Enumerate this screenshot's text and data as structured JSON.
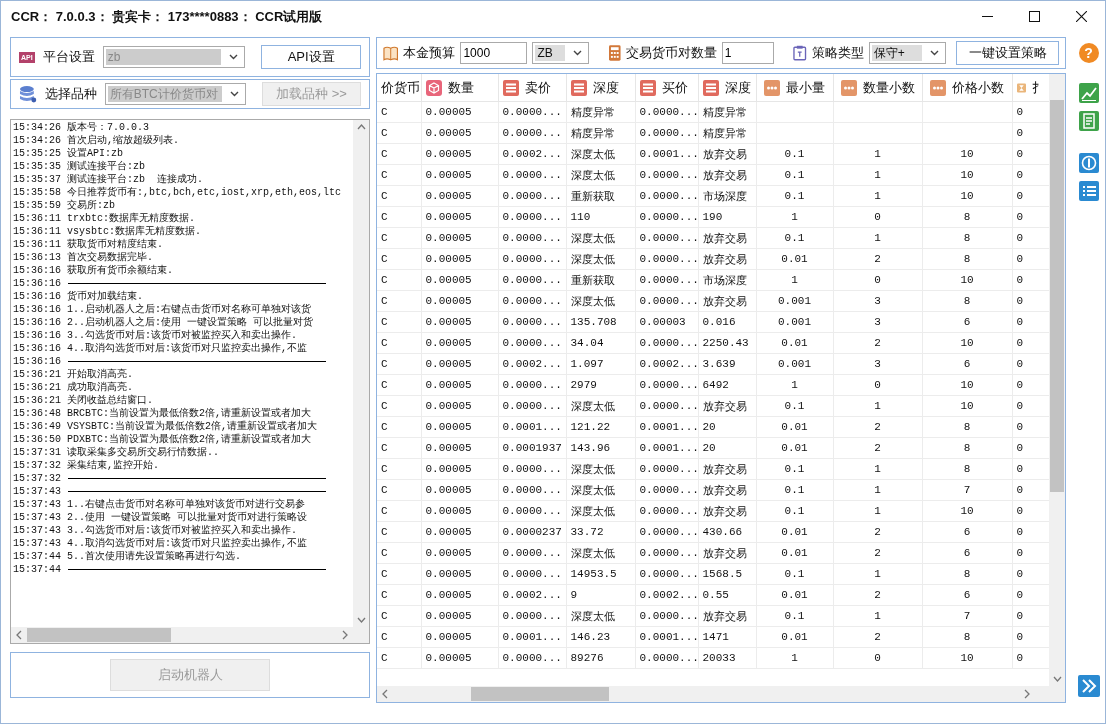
{
  "title_bar": {
    "title": "CCR： 7.0.0.3： 贵宾卡： 173****0883： CCR试用版"
  },
  "platform": {
    "badge": "API",
    "label": "平台设置",
    "dropdown": {
      "value": "zb",
      "disabled": true
    },
    "button": {
      "label": "API设置",
      "disabled": false
    }
  },
  "symbols": {
    "label": "选择品种",
    "dropdown": {
      "value": "所有BTC计价货币对",
      "disabled": true
    },
    "button": {
      "label": "加载品种 >>",
      "disabled": true
    }
  },
  "log": [
    {
      "kind": "text",
      "time": "15:34:26",
      "text": "版本号：7.0.0.3"
    },
    {
      "kind": "text",
      "time": "15:34:26",
      "text": "首次启动,缩放超级列表."
    },
    {
      "kind": "text",
      "time": "15:35:25",
      "text": "设置API:zb"
    },
    {
      "kind": "text",
      "time": "15:35:35",
      "text": "测试连接平台:zb"
    },
    {
      "kind": "text",
      "time": "15:35:37",
      "text": "测试连接平台:zb  连接成功."
    },
    {
      "kind": "text",
      "time": "15:35:58",
      "text": "今日推荐货币有:,btc,bch,etc,iost,xrp,eth,eos,ltc"
    },
    {
      "kind": "text",
      "time": "15:35:59",
      "text": "交易所:zb"
    },
    {
      "kind": "text",
      "time": "15:36:11",
      "text": "trxbtc:数据库无精度数据."
    },
    {
      "kind": "text",
      "time": "15:36:11",
      "text": "vsysbtc:数据库无精度数据."
    },
    {
      "kind": "text",
      "time": "15:36:11",
      "text": "获取货币对精度结束."
    },
    {
      "kind": "text",
      "time": "15:36:13",
      "text": "首次交易数据完毕."
    },
    {
      "kind": "text",
      "time": "15:36:16",
      "text": "获取所有货币余额结束."
    },
    {
      "kind": "rule",
      "time": "15:36:16"
    },
    {
      "kind": "text",
      "time": "15:36:16",
      "text": "货币对加载结束."
    },
    {
      "kind": "text",
      "time": "15:36:16",
      "text": "1..启动机器人之后:右键点击货币对名称可单独对该货"
    },
    {
      "kind": "text",
      "time": "15:36:16",
      "text": "2..启动机器人之后:使用 一键设置策略 可以批量对货"
    },
    {
      "kind": "text",
      "time": "15:36:16",
      "text": "3..勾选货币对后:该货币对被监控买入和卖出操作."
    },
    {
      "kind": "text",
      "time": "15:36:16",
      "text": "4..取消勾选货币对后:该货币对只监控卖出操作,不监"
    },
    {
      "kind": "rule",
      "time": "15:36:16"
    },
    {
      "kind": "text",
      "time": "15:36:21",
      "text": "开始取消高亮."
    },
    {
      "kind": "text",
      "time": "15:36:21",
      "text": "成功取消高亮."
    },
    {
      "kind": "text",
      "time": "15:36:21",
      "text": "关闭收益总结窗口."
    },
    {
      "kind": "text",
      "time": "15:36:48",
      "text": "BRCBTC:当前设置为最低倍数2倍,请重新设置或者加大"
    },
    {
      "kind": "text",
      "time": "15:36:49",
      "text": "VSYSBTC:当前设置为最低倍数2倍,请重新设置或者加大"
    },
    {
      "kind": "text",
      "time": "15:36:50",
      "text": "PDXBTC:当前设置为最低倍数2倍,请重新设置或者加大"
    },
    {
      "kind": "text",
      "time": "15:37:31",
      "text": "读取采集多交易所交易行情数据.."
    },
    {
      "kind": "text",
      "time": "15:37:32",
      "text": "采集结束,监控开始."
    },
    {
      "kind": "rule",
      "time": "15:37:32"
    },
    {
      "kind": "rule",
      "time": "15:37:43"
    },
    {
      "kind": "text",
      "time": "15:37:43",
      "text": "1..右键点击货币对名称可单独对该货币对进行交易参"
    },
    {
      "kind": "text",
      "time": "15:37:43",
      "text": "2..使用 一键设置策略 可以批量对货币对进行策略设"
    },
    {
      "kind": "text",
      "time": "15:37:43",
      "text": "3..勾选货币对后:该货币对被监控买入和卖出操作."
    },
    {
      "kind": "text",
      "time": "15:37:43",
      "text": "4..取消勾选货币对后:该货币对只监控卖出操作,不监"
    },
    {
      "kind": "text",
      "time": "15:37:44",
      "text": "5..首次使用请先设置策略再进行勾选."
    },
    {
      "kind": "rule",
      "time": "15:37:44"
    }
  ],
  "start_button": {
    "label": "启动机器人",
    "disabled": true
  },
  "toolbar": {
    "budget": {
      "label": "本金预算",
      "value": "1000"
    },
    "currency": {
      "value": "ZB",
      "disabled": false
    },
    "pairs": {
      "label": "交易货币对数量",
      "value": "1"
    },
    "strategy": {
      "label": "策略类型",
      "dropdown": {
        "value": "保守+",
        "disabled": false
      }
    },
    "button": {
      "label": "一键设置策略"
    }
  },
  "table": {
    "columns": [
      {
        "label": "价货币"
      },
      {
        "label": "数量"
      },
      {
        "label": "卖价"
      },
      {
        "label": "深度"
      },
      {
        "label": "买价"
      },
      {
        "label": "深度"
      },
      {
        "label": "最小量"
      },
      {
        "label": "数量小数"
      },
      {
        "label": "价格小数"
      },
      {
        "label": "扌"
      }
    ],
    "rows": [
      [
        "C",
        "0.00005",
        "0.0000...",
        "精度异常",
        "0.0000...",
        "精度异常",
        "",
        "",
        "",
        "0"
      ],
      [
        "C",
        "0.00005",
        "0.0000...",
        "精度异常",
        "0.0000...",
        "精度异常",
        "",
        "",
        "",
        "0"
      ],
      [
        "C",
        "0.00005",
        "0.0002...",
        "深度太低",
        "0.0001...",
        "放弃交易",
        "0.1",
        "1",
        "10",
        "0"
      ],
      [
        "C",
        "0.00005",
        "0.0000...",
        "深度太低",
        "0.0000...",
        "放弃交易",
        "0.1",
        "1",
        "10",
        "0"
      ],
      [
        "C",
        "0.00005",
        "0.0000...",
        "重新获取",
        "0.0000...",
        "市场深度",
        "0.1",
        "1",
        "10",
        "0"
      ],
      [
        "C",
        "0.00005",
        "0.0000...",
        "110",
        "0.0000...",
        "190",
        "1",
        "0",
        "8",
        "0"
      ],
      [
        "C",
        "0.00005",
        "0.0000...",
        "深度太低",
        "0.0000...",
        "放弃交易",
        "0.1",
        "1",
        "8",
        "0"
      ],
      [
        "C",
        "0.00005",
        "0.0000...",
        "深度太低",
        "0.0000...",
        "放弃交易",
        "0.01",
        "2",
        "8",
        "0"
      ],
      [
        "C",
        "0.00005",
        "0.0000...",
        "重新获取",
        "0.0000...",
        "市场深度",
        "1",
        "0",
        "10",
        "0"
      ],
      [
        "C",
        "0.00005",
        "0.0000...",
        "深度太低",
        "0.0000...",
        "放弃交易",
        "0.001",
        "3",
        "8",
        "0"
      ],
      [
        "C",
        "0.00005",
        "0.0000...",
        "135.708",
        "0.00003",
        "0.016",
        "0.001",
        "3",
        "6",
        "0"
      ],
      [
        "C",
        "0.00005",
        "0.0000...",
        "34.04",
        "0.0000...",
        "2250.43",
        "0.01",
        "2",
        "10",
        "0"
      ],
      [
        "C",
        "0.00005",
        "0.0002...",
        "1.097",
        "0.0002...",
        "3.639",
        "0.001",
        "3",
        "6",
        "0"
      ],
      [
        "C",
        "0.00005",
        "0.0000...",
        "2979",
        "0.0000...",
        "6492",
        "1",
        "0",
        "10",
        "0"
      ],
      [
        "C",
        "0.00005",
        "0.0000...",
        "深度太低",
        "0.0000...",
        "放弃交易",
        "0.1",
        "1",
        "10",
        "0"
      ],
      [
        "C",
        "0.00005",
        "0.0001...",
        "121.22",
        "0.0001...",
        "20",
        "0.01",
        "2",
        "8",
        "0"
      ],
      [
        "C",
        "0.00005",
        "0.0001937",
        "143.96",
        "0.0001...",
        "20",
        "0.01",
        "2",
        "8",
        "0"
      ],
      [
        "C",
        "0.00005",
        "0.0000...",
        "深度太低",
        "0.0000...",
        "放弃交易",
        "0.1",
        "1",
        "8",
        "0"
      ],
      [
        "C",
        "0.00005",
        "0.0000...",
        "深度太低",
        "0.0000...",
        "放弃交易",
        "0.1",
        "1",
        "7",
        "0"
      ],
      [
        "C",
        "0.00005",
        "0.0000...",
        "深度太低",
        "0.0000...",
        "放弃交易",
        "0.1",
        "1",
        "10",
        "0"
      ],
      [
        "C",
        "0.00005",
        "0.0000237",
        "33.72",
        "0.0000...",
        "430.66",
        "0.01",
        "2",
        "6",
        "0"
      ],
      [
        "C",
        "0.00005",
        "0.0000...",
        "深度太低",
        "0.0000...",
        "放弃交易",
        "0.01",
        "2",
        "6",
        "0"
      ],
      [
        "C",
        "0.00005",
        "0.0000...",
        "14953.5",
        "0.0000...",
        "1568.5",
        "0.1",
        "1",
        "8",
        "0"
      ],
      [
        "C",
        "0.00005",
        "0.0002...",
        "9",
        "0.0002...",
        "0.55",
        "0.01",
        "2",
        "6",
        "0"
      ],
      [
        "C",
        "0.00005",
        "0.0000...",
        "深度太低",
        "0.0000...",
        "放弃交易",
        "0.1",
        "1",
        "7",
        "0"
      ],
      [
        "C",
        "0.00005",
        "0.0001...",
        "146.23",
        "0.0001...",
        "1471",
        "0.01",
        "2",
        "8",
        "0"
      ],
      [
        "C",
        "0.00005",
        "0.0000...",
        "89276",
        "0.0000...",
        "20033",
        "1",
        "0",
        "10",
        "0"
      ]
    ]
  },
  "sidebar": {
    "help": "?"
  }
}
